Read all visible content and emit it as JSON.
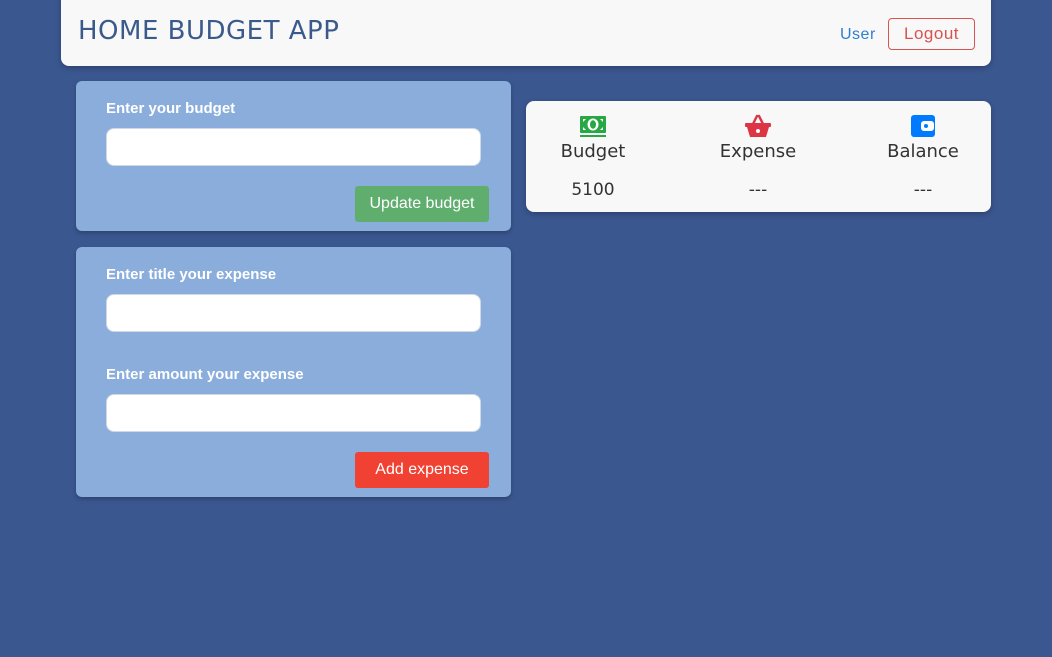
{
  "header": {
    "title": "HOME BUDGET APP",
    "user_link": "User",
    "logout_label": "Logout"
  },
  "budget_form": {
    "label": "Enter your budget",
    "value": "",
    "button_label": "Update budget",
    "button_color": "#5fae6e"
  },
  "expense_form": {
    "title_label": "Enter title your expense",
    "title_value": "",
    "amount_label": "Enter amount your expense",
    "amount_value": "",
    "button_label": "Add expense",
    "button_color": "#f04132"
  },
  "summary": {
    "budget": {
      "icon": "money-bill-icon",
      "label": "Budget",
      "value": "5100",
      "color": "#28a745"
    },
    "expense": {
      "icon": "shopping-basket-icon",
      "label": "Expense",
      "value": "---",
      "color": "#dc3545"
    },
    "balance": {
      "icon": "wallet-icon",
      "label": "Balance",
      "value": "---",
      "color": "#007bff"
    }
  },
  "colors": {
    "background": "#3b5790",
    "card": "#8aaddc",
    "header_title": "#3b5a8c",
    "logout": "#d9534f",
    "user_link": "#2f7fd0"
  }
}
